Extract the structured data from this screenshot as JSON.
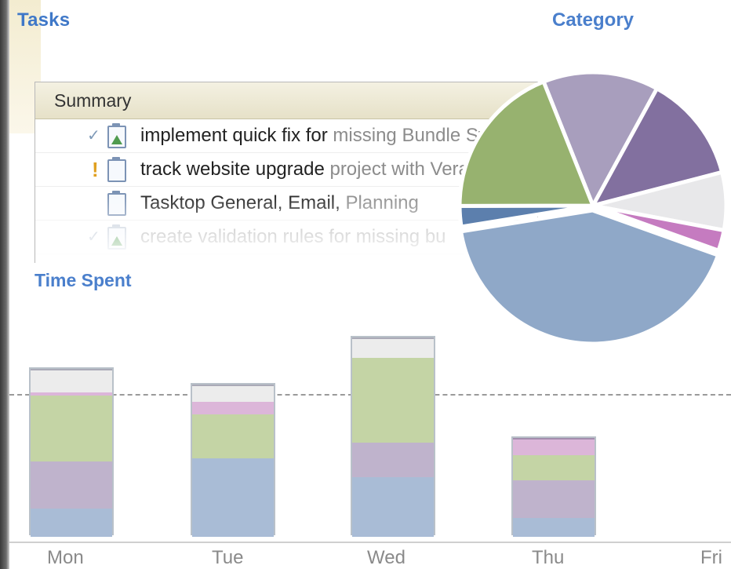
{
  "header": {
    "title": "Tasks"
  },
  "category": {
    "title": "Category"
  },
  "time_spent": {
    "title": "Time Spent"
  },
  "tasks_table": {
    "column_header": "Summary",
    "rows": [
      {
        "status": "check",
        "text": "implement quick fix for",
        "muted": "missing Bundle Symbol",
        "faded": false,
        "icon": "task-icon-green-triangle"
      },
      {
        "status": "priority",
        "text": "track website upgrade",
        "muted": "project with Veratto",
        "faded": false,
        "icon": "task-icon"
      },
      {
        "status": "none",
        "text": "Tasktop General, Email,",
        "muted": "Planning",
        "faded": false,
        "icon": "task-icon"
      },
      {
        "status": "check",
        "text": "create validation rules for missing bu",
        "muted": "",
        "faded": true,
        "icon": "task-icon-green-triangle"
      }
    ]
  },
  "days": [
    "Mon",
    "Tue",
    "Wed",
    "Thu",
    "Fri"
  ],
  "colors": {
    "title": "#3f78c8",
    "pie_green": "#97b26f",
    "pie_lavender": "#a89ebd",
    "pie_purple": "#82709f",
    "pie_grey": "#e8e8ea",
    "pie_pink": "#c57bc0",
    "pie_blue": "#8fa8c8",
    "pie_darkblue": "#5c7fad"
  },
  "chart_data": [
    {
      "type": "pie",
      "title": "Category",
      "slices": [
        {
          "color": "#a89ebd",
          "value": 0.14
        },
        {
          "color": "#82709f",
          "value": 0.13
        },
        {
          "color": "#e8e8ea",
          "value": 0.07
        },
        {
          "color": "#c57bc0",
          "value": 0.025
        },
        {
          "color": "#8fa8c8",
          "value": 0.42
        },
        {
          "color": "#5c7fad",
          "value": 0.025
        },
        {
          "color": "#97b26f",
          "value": 0.19
        }
      ]
    },
    {
      "type": "bar",
      "title": "Time Spent",
      "categories": [
        "Mon",
        "Tue",
        "Wed",
        "Thu",
        "Fri"
      ],
      "stacked": true,
      "series": [
        {
          "color": "#a9bcd6",
          "values": [
            0.9,
            2.5,
            1.9,
            0.6,
            0
          ]
        },
        {
          "color": "#bfb3cc",
          "values": [
            1.5,
            0,
            1.1,
            1.2,
            0
          ]
        },
        {
          "color": "#c4d4a5",
          "values": [
            2.1,
            1.4,
            2.7,
            0.8,
            0
          ]
        },
        {
          "color": "#dcb6d9",
          "values": [
            0.1,
            0.4,
            0,
            0.5,
            0
          ]
        },
        {
          "color": "#ececec",
          "values": [
            0.7,
            0.5,
            0.6,
            0,
            0
          ]
        }
      ],
      "reference_line": 3.9,
      "ylim": [
        0,
        7.5
      ]
    }
  ]
}
